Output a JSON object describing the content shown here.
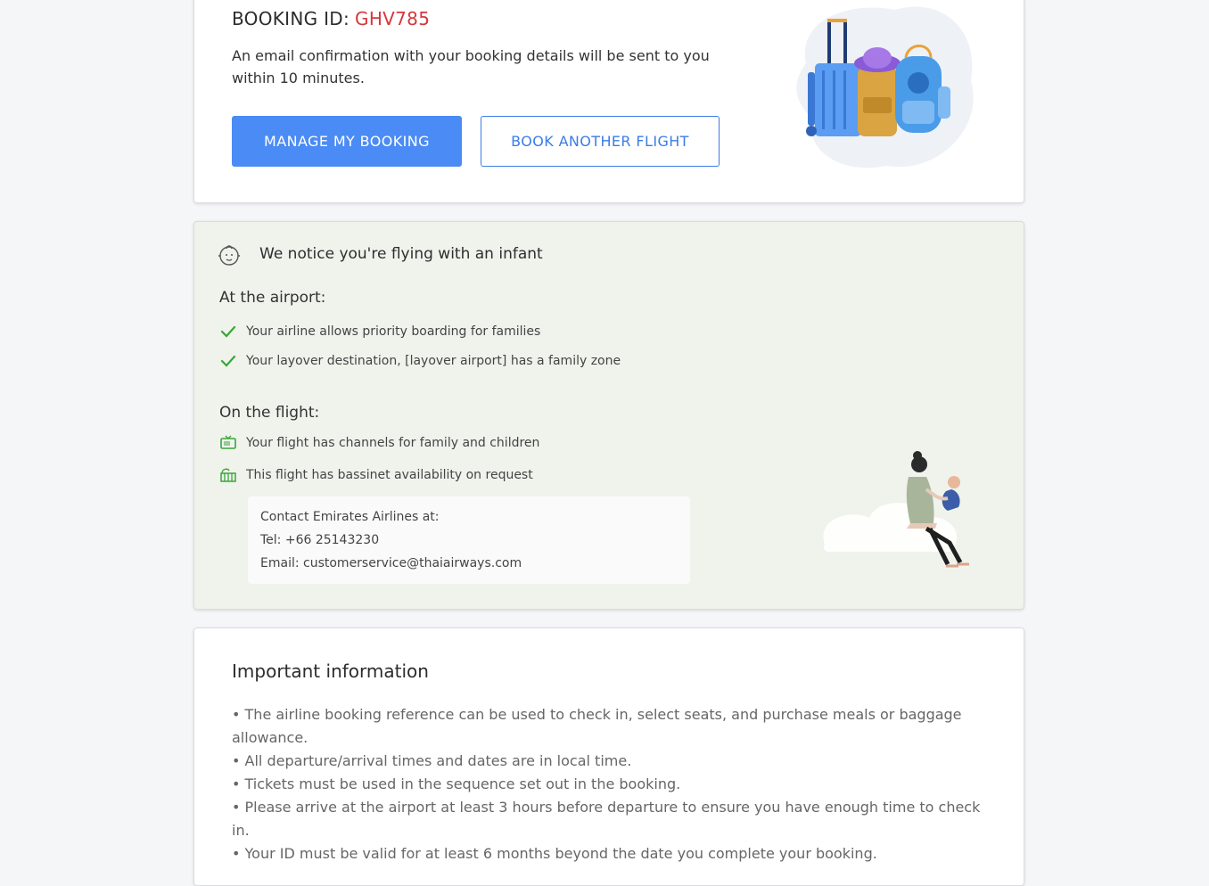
{
  "booking": {
    "id_label": "BOOKING ID:",
    "id_value": "GHV785",
    "confirmation_text": "An email confirmation with your booking details will be sent to you within 10 minutes.",
    "manage_button": "MANAGE MY BOOKING",
    "book_another_button": "BOOK ANOTHER FLIGHT"
  },
  "infant": {
    "title": "We notice you're flying with an infant",
    "airport_heading": "At the airport:",
    "airport_items": [
      "Your airline allows priority boarding for families",
      "Your layover destination, [layover airport] has a family zone"
    ],
    "flight_heading": "On the flight:",
    "flight_items": [
      "Your flight has channels for family and children",
      "This flight has bassinet availability on request"
    ],
    "contact": {
      "line1": "Contact Emirates Airlines at:",
      "line2": "Tel: +66 25143230",
      "line3": "Email: customerservice@thaiairways.com"
    }
  },
  "important": {
    "title": "Important information",
    "items": [
      "• The airline booking reference can be used to check in, select seats, and purchase meals or baggage allowance.",
      "• All departure/arrival times and dates are in local time.",
      "• Tickets must be used in the sequence set out in the booking.",
      "• Please arrive at the airport at least 3 hours before departure to ensure you have enough time to check in.",
      "• Your ID must be valid for at least 6 months beyond the date you complete your booking."
    ]
  },
  "colors": {
    "accent_blue": "#4b8bf5",
    "booking_id_red": "#d6373a",
    "check_green": "#3aa53a",
    "infant_bg": "#eff3ec"
  }
}
